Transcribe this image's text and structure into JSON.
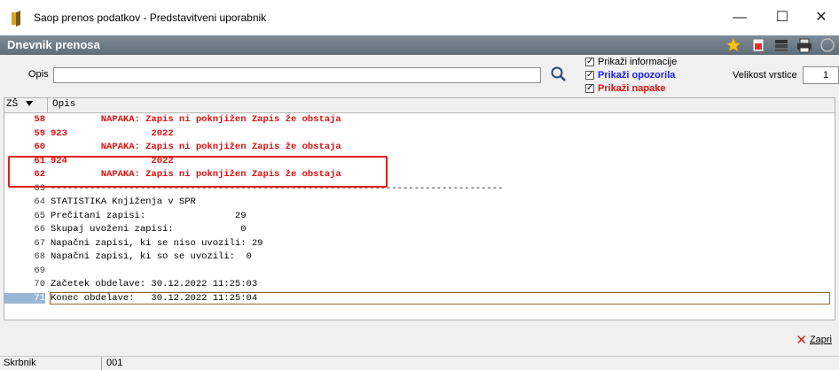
{
  "window": {
    "title": "Saop prenos podatkov - Predstavitveni uporabnik",
    "minimize": "—",
    "maximize": "☐",
    "close": "✕"
  },
  "panel": {
    "title": "Dnevnik prenosa"
  },
  "filter": {
    "opis_label": "Opis",
    "opis_value": "",
    "checkboxes": [
      {
        "label": "Prikaži informacije",
        "checked": true,
        "color": "#000000"
      },
      {
        "label": "Prikaži opozorila",
        "checked": true,
        "color": "#1a1aff"
      },
      {
        "label": "Prikaži napake",
        "checked": true,
        "color": "#e01010"
      }
    ],
    "row_size_label": "Velikost vrstice",
    "row_size_value": "1"
  },
  "grid": {
    "col_zs": "ZŠ",
    "col_opis": "Opis",
    "rows": [
      {
        "num": "58",
        "text": "         NAPAKA: Zapis ni poknjižen Zapis že obstaja",
        "type": "err"
      },
      {
        "num": "59",
        "text": "923               2022",
        "type": "err"
      },
      {
        "num": "60",
        "text": "         NAPAKA: Zapis ni poknjižen Zapis že obstaja",
        "type": "err"
      },
      {
        "num": "61",
        "text": "924               2022",
        "type": "err"
      },
      {
        "num": "62",
        "text": "         NAPAKA: Zapis ni poknjižen Zapis že obstaja",
        "type": "err"
      },
      {
        "num": "63",
        "text": "---------------------------------------------------------------------------------",
        "type": "info"
      },
      {
        "num": "64",
        "text": "STATISTIKA Knjiženja v SPR",
        "type": "info"
      },
      {
        "num": "65",
        "text": "Prečitani zapisi:                29",
        "type": "info"
      },
      {
        "num": "66",
        "text": "Skupaj uvoženi zapisi:            0",
        "type": "info"
      },
      {
        "num": "67",
        "text": "Napačni zapisi, ki se niso uvozili: 29",
        "type": "info"
      },
      {
        "num": "68",
        "text": "Napačni zapisi, ki so se uvozili:  0",
        "type": "info"
      },
      {
        "num": "69",
        "text": "",
        "type": "info"
      },
      {
        "num": "70",
        "text": "Začetek obdelave: 30.12.2022 11:25:03",
        "type": "info"
      },
      {
        "num": "71",
        "text": "Konec obdelave:   30.12.2022 11:25:04",
        "type": "sel"
      }
    ]
  },
  "footer": {
    "close_label": "Zapri"
  },
  "statusbar": {
    "user": "Skrbnik",
    "code": "001"
  }
}
